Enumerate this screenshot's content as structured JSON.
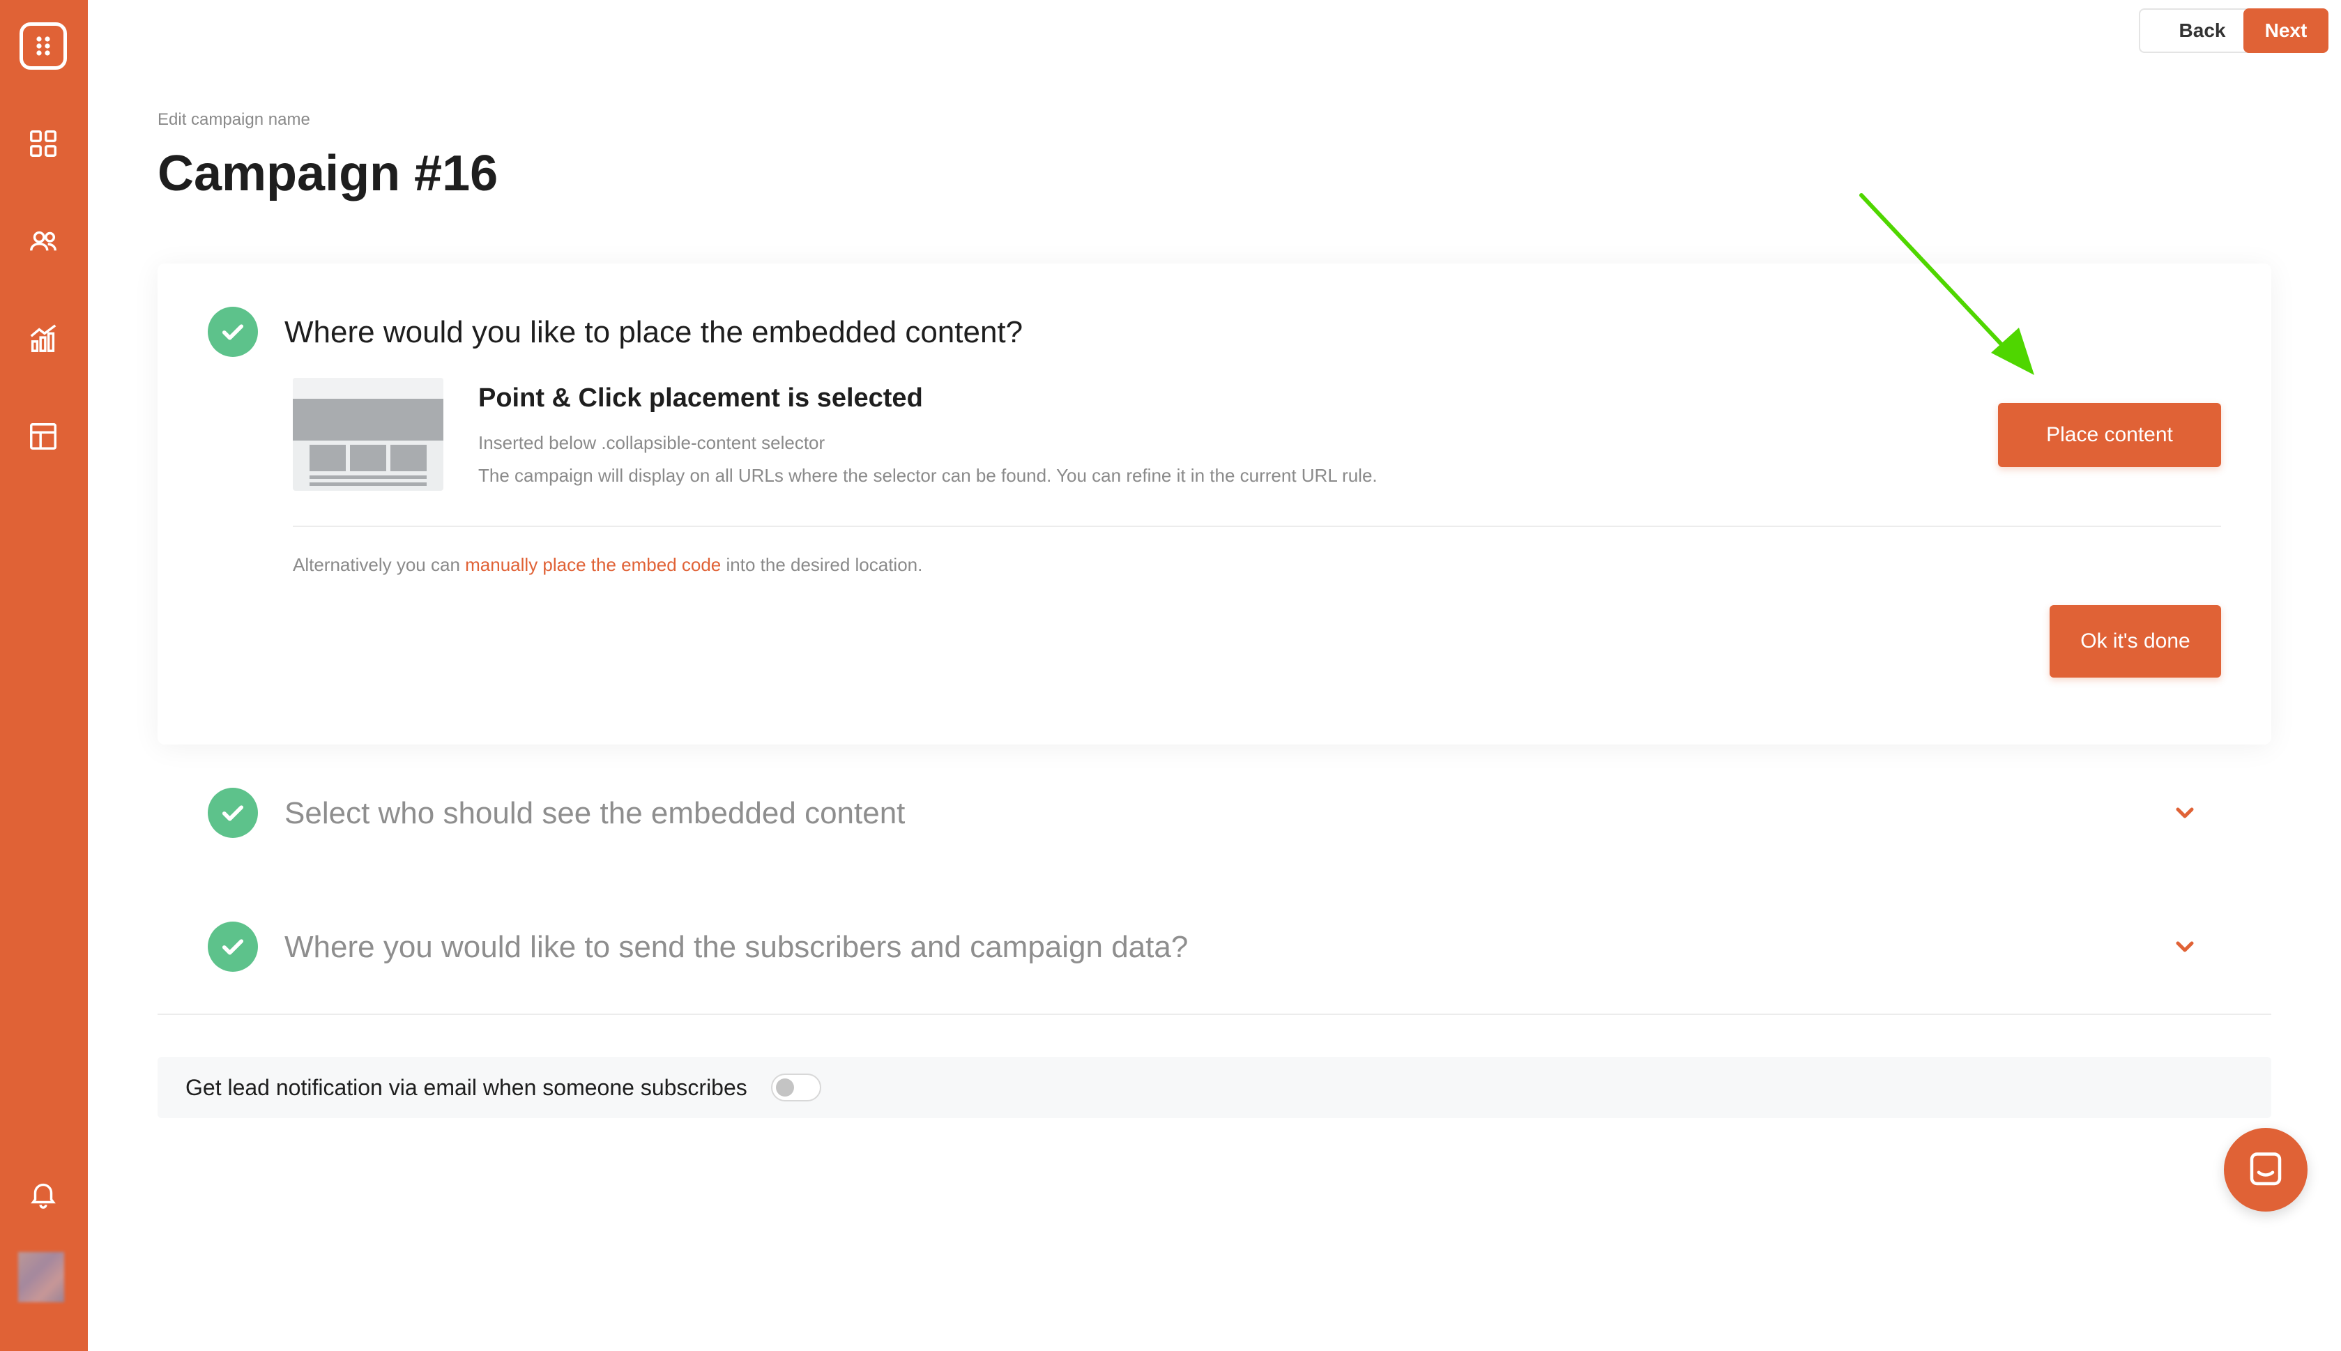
{
  "colors": {
    "brand": "#e06236",
    "success": "#5dc28b",
    "annotation_arrow": "#4fd600"
  },
  "sidebar": {
    "items": [
      {
        "name": "logo",
        "icon": "dots-grid-logo-icon"
      },
      {
        "name": "dashboard",
        "icon": "dashboard-grid-icon"
      },
      {
        "name": "audience",
        "icon": "users-icon"
      },
      {
        "name": "analytics",
        "icon": "chart-icon"
      },
      {
        "name": "templates",
        "icon": "layout-icon"
      }
    ],
    "bottom": [
      {
        "name": "notifications",
        "icon": "bell-icon"
      },
      {
        "name": "avatar",
        "icon": "user-avatar"
      }
    ]
  },
  "topbar": {
    "back_label": "Back",
    "next_label": "Next"
  },
  "header": {
    "edit_label": "Edit campaign name",
    "title": "Campaign #16"
  },
  "steps": [
    {
      "title": "Where would you like to place the embedded content?",
      "state": "expanded",
      "selection": {
        "title": "Point & Click placement is selected",
        "line1": "Inserted below .collapsible-content selector",
        "line2": "The campaign will display on all URLs where the selector can be found. You can refine it in the current URL rule."
      },
      "place_button": "Place content",
      "alt_prefix": "Alternatively you can ",
      "alt_link": "manually place the embed code",
      "alt_suffix": " into the desired location.",
      "done_button": "Ok it's done"
    },
    {
      "title": "Select who should see the embedded content",
      "state": "collapsed"
    },
    {
      "title": "Where you would like to send the subscribers and campaign data?",
      "state": "collapsed"
    }
  ],
  "notification": {
    "label": "Get lead notification via email when someone subscribes",
    "enabled": false
  },
  "chat": {
    "icon": "chat-bubble-icon"
  }
}
